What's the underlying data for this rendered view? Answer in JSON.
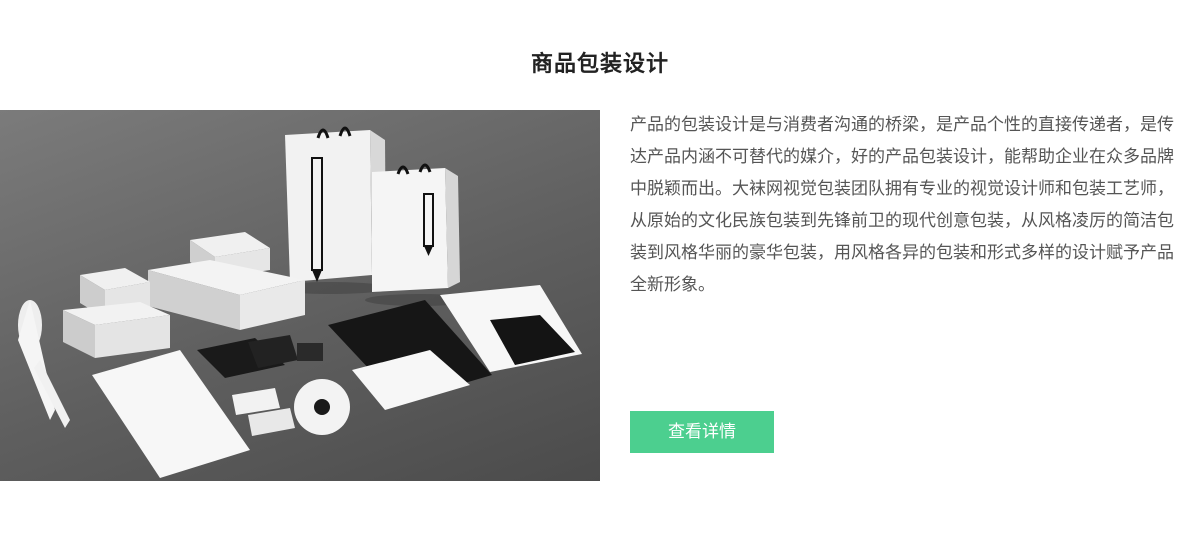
{
  "section": {
    "title": "商品包装设计",
    "description": "产品的包装设计是与消费者沟通的桥梁，是产品个性的直接传递者，是传达产品内涵不可替代的媒介，好的产品包装设计，能帮助企业在众多品牌中脱颖而出。大袜网视觉包装团队拥有专业的视觉设计师和包装工艺师，从原始的文化民族包装到先锋前卫的现代创意包装，从风格凌厉的简洁包装到风格华丽的豪华包装，用风格各异的包装和形式多样的设计赋予产品全新形象。",
    "button_label": "查看详情"
  },
  "colors": {
    "accent": "#4ccf8f",
    "title": "#222222",
    "text": "#555555"
  }
}
